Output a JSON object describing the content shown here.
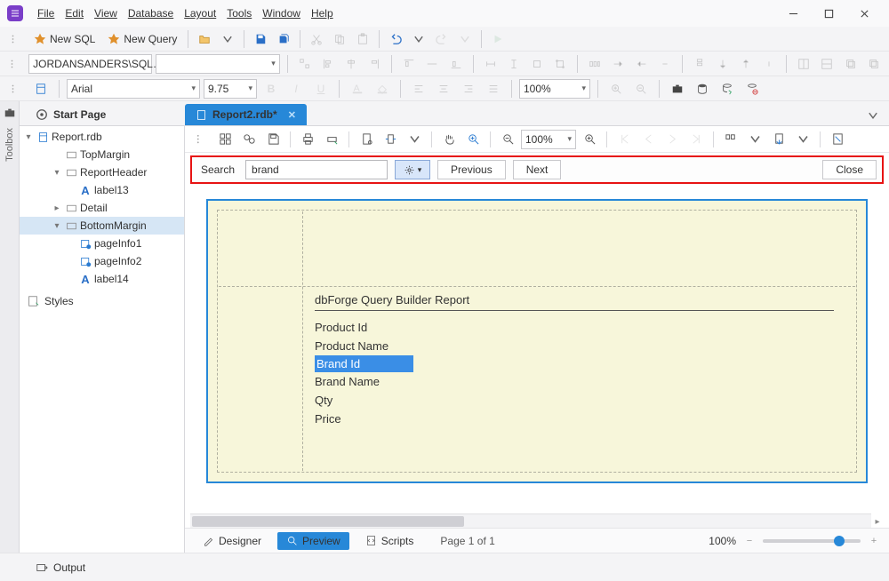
{
  "menu": {
    "file": "File",
    "edit": "Edit",
    "view": "View",
    "database": "Database",
    "layout": "Layout",
    "tools": "Tools",
    "window": "Window",
    "help": "Help"
  },
  "toolbar": {
    "new_sql": "New SQL",
    "new_query": "New Query",
    "connection": "JORDANSANDERS\\SQL…",
    "font_name": "Arial",
    "font_size": "9.75",
    "zoom": "100%",
    "preview_zoom": "100%"
  },
  "tabs": {
    "start": "Start Page",
    "report": "Report2.rdb*"
  },
  "tree": {
    "root": "Report.rdb",
    "rows": [
      {
        "label": "TopMargin",
        "icon": "section",
        "indent": 2
      },
      {
        "label": "ReportHeader",
        "icon": "section",
        "indent": 2,
        "expander": "v"
      },
      {
        "label": "label13",
        "icon": "A",
        "indent": 3
      },
      {
        "label": "Detail",
        "icon": "section",
        "indent": 2,
        "expander": ">"
      },
      {
        "label": "BottomMargin",
        "icon": "section",
        "indent": 2,
        "expander": "v",
        "selected": true
      },
      {
        "label": "pageInfo1",
        "icon": "pi",
        "indent": 3
      },
      {
        "label": "pageInfo2",
        "icon": "pi",
        "indent": 3
      },
      {
        "label": "label14",
        "icon": "A",
        "indent": 3
      }
    ],
    "styles": "Styles"
  },
  "search": {
    "label": "Search",
    "value": "brand",
    "previous": "Previous",
    "next": "Next",
    "close": "Close"
  },
  "report": {
    "title": "dbForge Query Builder Report",
    "rows": [
      "Product Id",
      "Product Name",
      "Brand Id",
      "Brand Name",
      "Qty",
      "Price"
    ],
    "highlight_index": 2
  },
  "bottom": {
    "designer": "Designer",
    "preview": "Preview",
    "scripts": "Scripts",
    "page": "Page 1 of 1",
    "zoom": "100%"
  },
  "status": {
    "output": "Output"
  }
}
